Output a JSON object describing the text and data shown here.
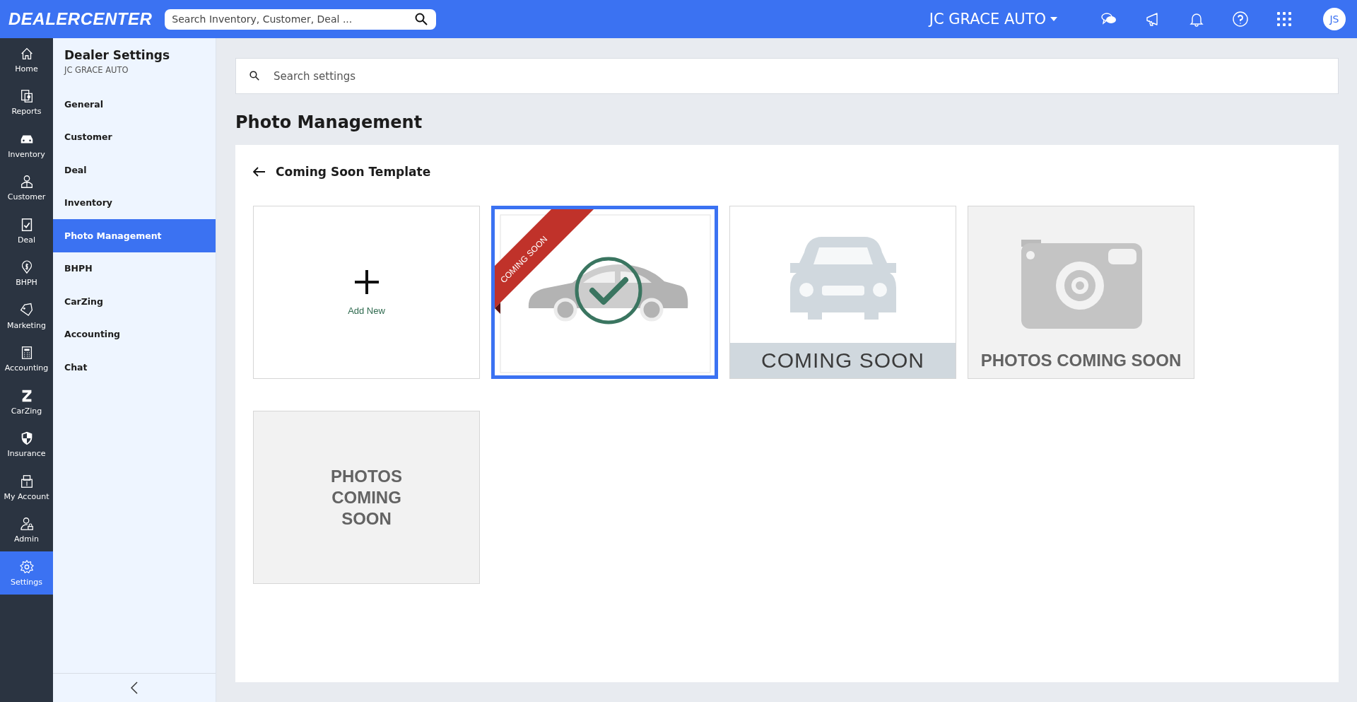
{
  "topbar": {
    "logo": "DEALERCENTER",
    "search": {
      "placeholder": "Search Inventory, Customer, Deal ..."
    },
    "dealer": "JC GRACE AUTO",
    "avatar": "JS"
  },
  "rail": [
    {
      "label": "Home",
      "selected": false
    },
    {
      "label": "Reports",
      "selected": false
    },
    {
      "label": "Inventory",
      "selected": false
    },
    {
      "label": "Customer",
      "selected": false
    },
    {
      "label": "Deal",
      "selected": false
    },
    {
      "label": "BHPH",
      "selected": false
    },
    {
      "label": "Marketing",
      "selected": false
    },
    {
      "label": "Accounting",
      "selected": false
    },
    {
      "label": "CarZing",
      "selected": false
    },
    {
      "label": "Insurance",
      "selected": false
    },
    {
      "label": "My Account",
      "selected": false
    },
    {
      "label": "Admin",
      "selected": false
    },
    {
      "label": "Settings",
      "selected": true
    }
  ],
  "sidebar": {
    "title": "Dealer Settings",
    "subtitle": "JC GRACE AUTO",
    "items": [
      {
        "label": "General",
        "selected": false
      },
      {
        "label": "Customer",
        "selected": false
      },
      {
        "label": "Deal",
        "selected": false
      },
      {
        "label": "Inventory",
        "selected": false
      },
      {
        "label": "Photo Management",
        "selected": true
      },
      {
        "label": "BHPH",
        "selected": false
      },
      {
        "label": "CarZing",
        "selected": false
      },
      {
        "label": "Accounting",
        "selected": false
      },
      {
        "label": "Chat",
        "selected": false
      }
    ]
  },
  "settings_search": {
    "placeholder": "Search settings"
  },
  "page_title": "Photo Management",
  "section_title": "Coming Soon Template",
  "templates": [
    {
      "kind": "add",
      "label": "Add New"
    },
    {
      "kind": "ribbon-car",
      "text": "COMING SOON",
      "selected": true
    },
    {
      "kind": "car-banner",
      "text": "COMING SOON",
      "selected": false
    },
    {
      "kind": "camera",
      "text": "PHOTOS COMING SOON",
      "selected": false
    },
    {
      "kind": "text",
      "text": "PHOTOS\nCOMING\nSOON",
      "selected": false
    }
  ]
}
